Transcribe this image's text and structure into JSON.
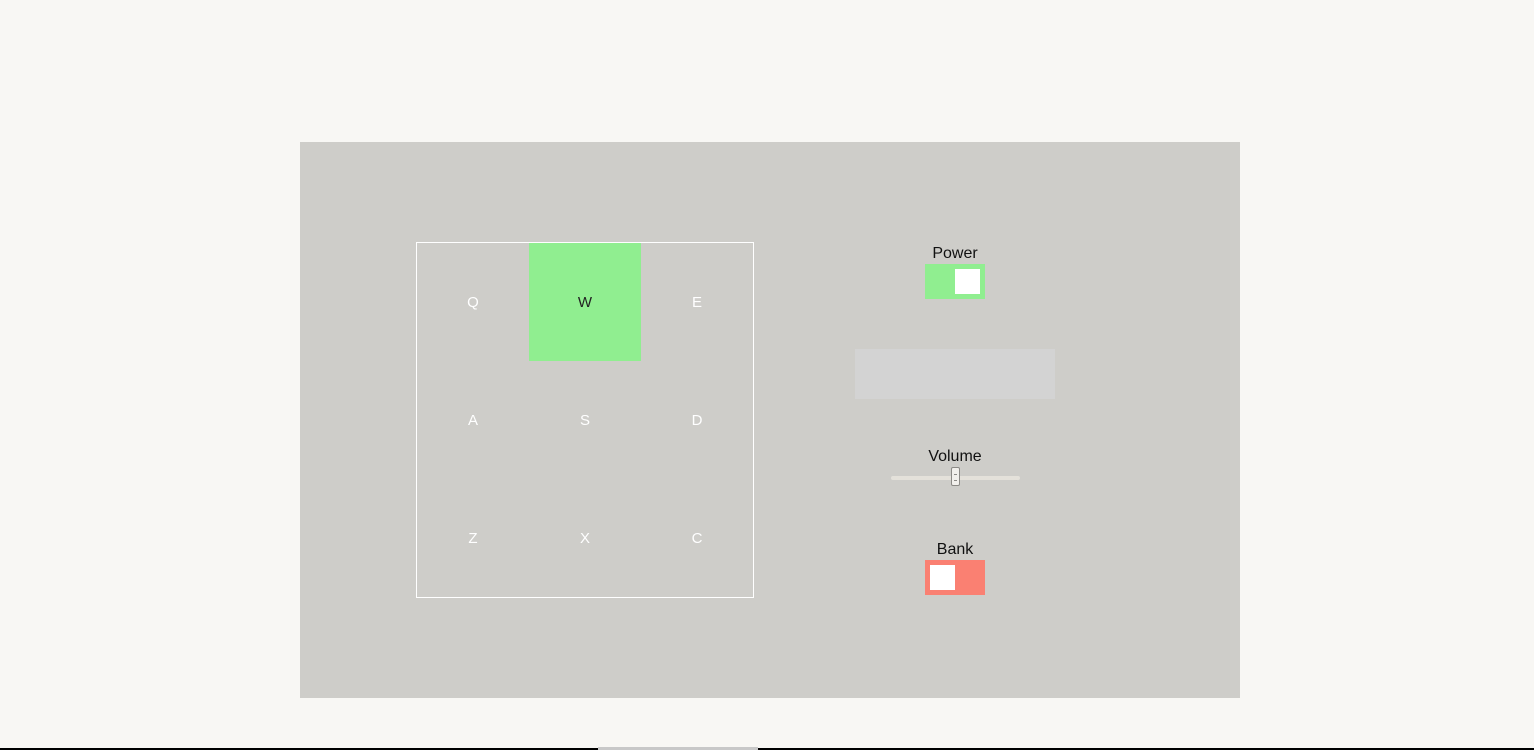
{
  "pads": [
    {
      "key": "Q",
      "active": false
    },
    {
      "key": "W",
      "active": true
    },
    {
      "key": "E",
      "active": false
    },
    {
      "key": "A",
      "active": false
    },
    {
      "key": "S",
      "active": false
    },
    {
      "key": "D",
      "active": false
    },
    {
      "key": "Z",
      "active": false
    },
    {
      "key": "X",
      "active": false
    },
    {
      "key": "C",
      "active": false
    }
  ],
  "power": {
    "label": "Power",
    "on": true,
    "color": "#90ee90"
  },
  "display": {
    "text": ""
  },
  "volume": {
    "label": "Volume",
    "value": 0.5
  },
  "bank": {
    "label": "Bank",
    "on": false,
    "color": "#fa8072"
  },
  "colors": {
    "page_background": "#f8f7f4",
    "machine_background": "#cecdc9",
    "pad_active": "#90ee90",
    "display_background": "#d3d3d3"
  }
}
